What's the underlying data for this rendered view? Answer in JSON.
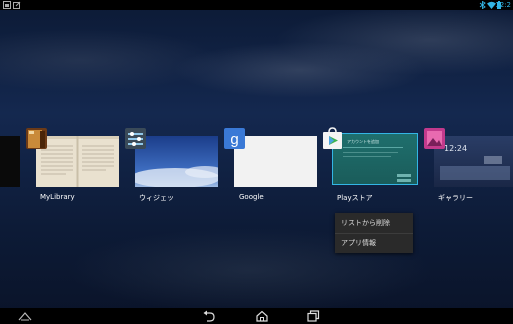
{
  "status_bar": {
    "time": "12:2",
    "accent": "#33b5e5"
  },
  "recent_apps": [
    {
      "label": "MyLibrary",
      "icon": "mylibrary-books-icon"
    },
    {
      "label": "ウィジェッ",
      "icon": "widgets-icon"
    },
    {
      "label": "Google",
      "icon": "google-g-icon"
    },
    {
      "label": "Playストア",
      "icon": "play-store-icon",
      "selected": true,
      "thumb_text": "アカウントを追加"
    },
    {
      "label": "ギャラリー",
      "icon": "gallery-icon",
      "thumb_time": "12:24"
    }
  ],
  "context_menu": {
    "items": [
      "リストから削除",
      "アプリ情報"
    ]
  },
  "nav_bar": {
    "icons": [
      "asus-logo-icon",
      "back-icon",
      "home-icon",
      "recent-apps-icon"
    ]
  }
}
